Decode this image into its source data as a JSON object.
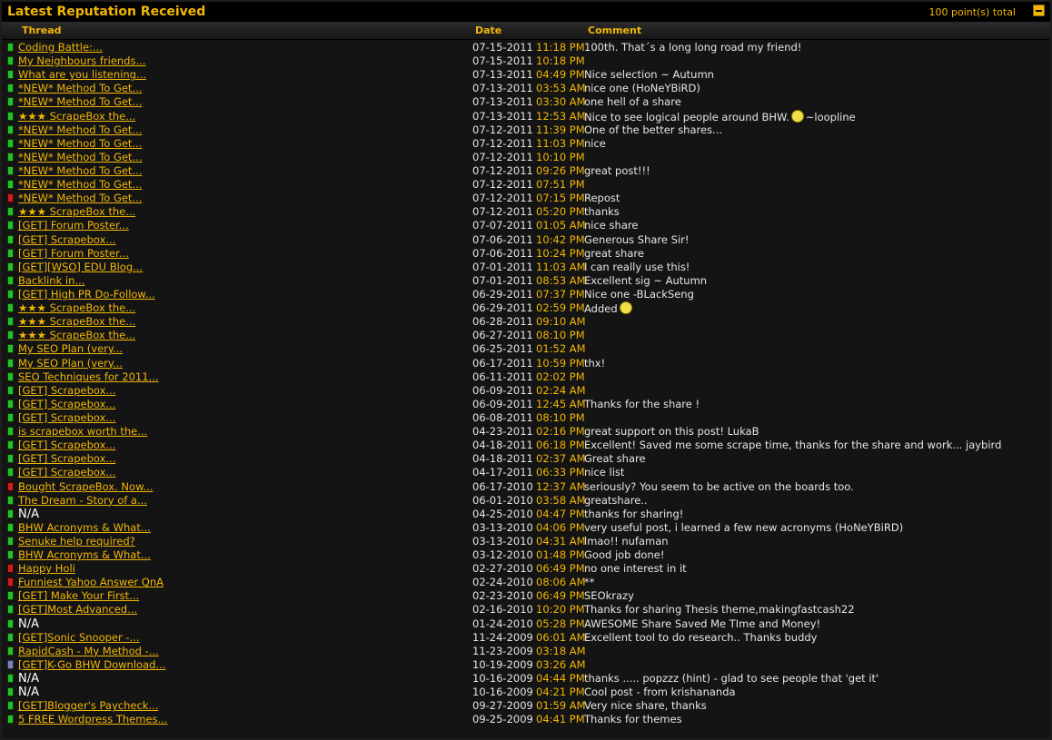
{
  "header": {
    "title": "Latest Reputation Received",
    "total": "100 point(s) total"
  },
  "columns": {
    "thread": "Thread",
    "date": "Date",
    "comment": "Comment"
  },
  "colors": {
    "accent": "#f2b705",
    "positive": "#23c12f",
    "negative": "#cc2020",
    "neutral": "#7b86b6",
    "background": "#141414"
  },
  "rows": [
    {
      "status": "pos",
      "thread": "Coding Battle:...",
      "date": "07-15-2011",
      "time": "11:18 PM",
      "comment": "100th. That´s a long long road my friend!"
    },
    {
      "status": "pos",
      "thread": "My Neighbours friends...",
      "date": "07-15-2011",
      "time": "10:18 PM",
      "comment": ""
    },
    {
      "status": "pos",
      "thread": "What are you listening...",
      "date": "07-13-2011",
      "time": "04:49 PM",
      "comment": "Nice selection ~ Autumn"
    },
    {
      "status": "pos",
      "thread": "*NEW* Method To Get...",
      "date": "07-13-2011",
      "time": "03:53 AM",
      "comment": "nice one (HoNeYBiRD)"
    },
    {
      "status": "pos",
      "thread": "*NEW* Method To Get...",
      "date": "07-13-2011",
      "time": "03:30 AM",
      "comment": "one hell of a share"
    },
    {
      "status": "pos",
      "thread": "★★★ ScrapeBox the...",
      "date": "07-13-2011",
      "time": "12:53 AM",
      "comment": "Nice to see logical people around BHW.",
      "smiley": true,
      "comment_after": "~loopline"
    },
    {
      "status": "pos",
      "thread": "*NEW* Method To Get...",
      "date": "07-12-2011",
      "time": "11:39 PM",
      "comment": "One of the better shares..."
    },
    {
      "status": "pos",
      "thread": "*NEW* Method To Get...",
      "date": "07-12-2011",
      "time": "11:03 PM",
      "comment": "nice"
    },
    {
      "status": "pos",
      "thread": "*NEW* Method To Get...",
      "date": "07-12-2011",
      "time": "10:10 PM",
      "comment": ""
    },
    {
      "status": "pos",
      "thread": "*NEW* Method To Get...",
      "date": "07-12-2011",
      "time": "09:26 PM",
      "comment": "great post!!!"
    },
    {
      "status": "pos",
      "thread": "*NEW* Method To Get...",
      "date": "07-12-2011",
      "time": "07:51 PM",
      "comment": ""
    },
    {
      "status": "neg",
      "thread": "*NEW* Method To Get...",
      "date": "07-12-2011",
      "time": "07:15 PM",
      "comment": "Repost"
    },
    {
      "status": "pos",
      "thread": "★★★ ScrapeBox the...",
      "date": "07-12-2011",
      "time": "05:20 PM",
      "comment": "thanks"
    },
    {
      "status": "pos",
      "thread": "[GET] Forum Poster...",
      "date": "07-07-2011",
      "time": "01:05 AM",
      "comment": "nice share"
    },
    {
      "status": "pos",
      "thread": "[GET] Scrapebox...",
      "date": "07-06-2011",
      "time": "10:42 PM",
      "comment": "Generous Share Sir!"
    },
    {
      "status": "pos",
      "thread": "[GET] Forum Poster...",
      "date": "07-06-2011",
      "time": "10:24 PM",
      "comment": "great share"
    },
    {
      "status": "pos",
      "thread": "[GET][WSO] EDU Blog...",
      "date": "07-01-2011",
      "time": "11:03 AM",
      "comment": "I can really use this!"
    },
    {
      "status": "pos",
      "thread": "Backlink in...",
      "date": "07-01-2011",
      "time": "08:53 AM",
      "comment": "Excellent sig ~ Autumn"
    },
    {
      "status": "pos",
      "thread": "[GET] High PR Do-Follow...",
      "date": "06-29-2011",
      "time": "07:37 PM",
      "comment": "Nice one -BLackSeng"
    },
    {
      "status": "pos",
      "thread": "★★★ ScrapeBox the...",
      "date": "06-29-2011",
      "time": "02:59 PM",
      "comment": "Added",
      "smiley": true,
      "comment_after": ""
    },
    {
      "status": "pos",
      "thread": "★★★ ScrapeBox the...",
      "date": "06-28-2011",
      "time": "09:10 AM",
      "comment": ""
    },
    {
      "status": "pos",
      "thread": "★★★ ScrapeBox the...",
      "date": "06-27-2011",
      "time": "08:10 PM",
      "comment": ""
    },
    {
      "status": "pos",
      "thread": "My SEO Plan (very...",
      "date": "06-25-2011",
      "time": "01:52 AM",
      "comment": ""
    },
    {
      "status": "pos",
      "thread": "My SEO Plan (very...",
      "date": "06-17-2011",
      "time": "10:59 PM",
      "comment": "thx!"
    },
    {
      "status": "pos",
      "thread": "SEO Techniques for 2011...",
      "date": "06-11-2011",
      "time": "02:02 PM",
      "comment": ""
    },
    {
      "status": "pos",
      "thread": "[GET] Scrapebox...",
      "date": "06-09-2011",
      "time": "02:24 AM",
      "comment": ""
    },
    {
      "status": "pos",
      "thread": "[GET] Scrapebox...",
      "date": "06-09-2011",
      "time": "12:45 AM",
      "comment": "Thanks for the share !"
    },
    {
      "status": "pos",
      "thread": "[GET] Scrapebox...",
      "date": "06-08-2011",
      "time": "08:10 PM",
      "comment": ""
    },
    {
      "status": "pos",
      "thread": "is scrapebox worth the...",
      "date": "04-23-2011",
      "time": "02:16 PM",
      "comment": "great support on this post! LukaB"
    },
    {
      "status": "pos",
      "thread": "[GET] Scrapebox...",
      "date": "04-18-2011",
      "time": "06:18 PM",
      "comment": "Excellent! Saved me some scrape time, thanks for the share and work... jaybird"
    },
    {
      "status": "pos",
      "thread": "[GET] Scrapebox...",
      "date": "04-18-2011",
      "time": "02:37 AM",
      "comment": "Great share"
    },
    {
      "status": "pos",
      "thread": "[GET] Scrapebox...",
      "date": "04-17-2011",
      "time": "06:33 PM",
      "comment": "nice list"
    },
    {
      "status": "neg",
      "thread": "Bought ScrapeBox. Now...",
      "date": "06-17-2010",
      "time": "12:37 AM",
      "comment": "seriously? You seem to be active on the boards too."
    },
    {
      "status": "pos",
      "thread": "The Dream - Story of a...",
      "date": "06-01-2010",
      "time": "03:58 AM",
      "comment": "greatshare.."
    },
    {
      "status": "pos",
      "thread": "N/A",
      "na": true,
      "date": "04-25-2010",
      "time": "04:47 PM",
      "comment": "thanks for sharing!"
    },
    {
      "status": "pos",
      "thread": "BHW Acronyms & What...",
      "date": "03-13-2010",
      "time": "04:06 PM",
      "comment": "very useful post, i learned a few new acronyms (HoNeYBiRD)"
    },
    {
      "status": "pos",
      "thread": "Senuke help required?",
      "date": "03-13-2010",
      "time": "04:31 AM",
      "comment": "lmao!! nufaman"
    },
    {
      "status": "pos",
      "thread": "BHW Acronyms & What...",
      "date": "03-12-2010",
      "time": "01:48 PM",
      "comment": "Good job done!"
    },
    {
      "status": "neg",
      "thread": "Happy Holi",
      "date": "02-27-2010",
      "time": "06:49 PM",
      "comment": "no one interest in it"
    },
    {
      "status": "neg",
      "thread": "Funniest Yahoo Answer QnA",
      "date": "02-24-2010",
      "time": "08:06 AM",
      "comment": "**"
    },
    {
      "status": "pos",
      "thread": "[GET] Make Your First...",
      "date": "02-23-2010",
      "time": "06:49 PM",
      "comment": "SEOkrazy"
    },
    {
      "status": "pos",
      "thread": "[GET]Most Advanced...",
      "date": "02-16-2010",
      "time": "10:20 PM",
      "comment": "Thanks for sharing Thesis theme,makingfastcash22"
    },
    {
      "status": "pos",
      "thread": "N/A",
      "na": true,
      "date": "01-24-2010",
      "time": "05:28 PM",
      "comment": "AWESOME Share Saved Me TIme and Money!"
    },
    {
      "status": "pos",
      "thread": "[GET]Sonic Snooper -...",
      "date": "11-24-2009",
      "time": "06:01 AM",
      "comment": "Excellent tool to do research.. Thanks buddy"
    },
    {
      "status": "pos",
      "thread": "RapidCash - My Method -...",
      "date": "11-23-2009",
      "time": "03:18 AM",
      "comment": ""
    },
    {
      "status": "neu",
      "thread": "[GET]K-Go BHW Download...",
      "date": "10-19-2009",
      "time": "03:26 AM",
      "comment": ""
    },
    {
      "status": "pos",
      "thread": "N/A",
      "na": true,
      "date": "10-16-2009",
      "time": "04:44 PM",
      "comment": "thanks ..... popzzz (hint) - glad to see people that 'get it'"
    },
    {
      "status": "pos",
      "thread": "N/A",
      "na": true,
      "date": "10-16-2009",
      "time": "04:21 PM",
      "comment": "Cool post - from krishananda"
    },
    {
      "status": "pos",
      "thread": "[GET]Blogger's Paycheck...",
      "date": "09-27-2009",
      "time": "01:59 AM",
      "comment": "Very nice share, thanks"
    },
    {
      "status": "pos",
      "thread": "5 FREE Wordpress Themes...",
      "date": "09-25-2009",
      "time": "04:41 PM",
      "comment": "Thanks for themes"
    }
  ]
}
